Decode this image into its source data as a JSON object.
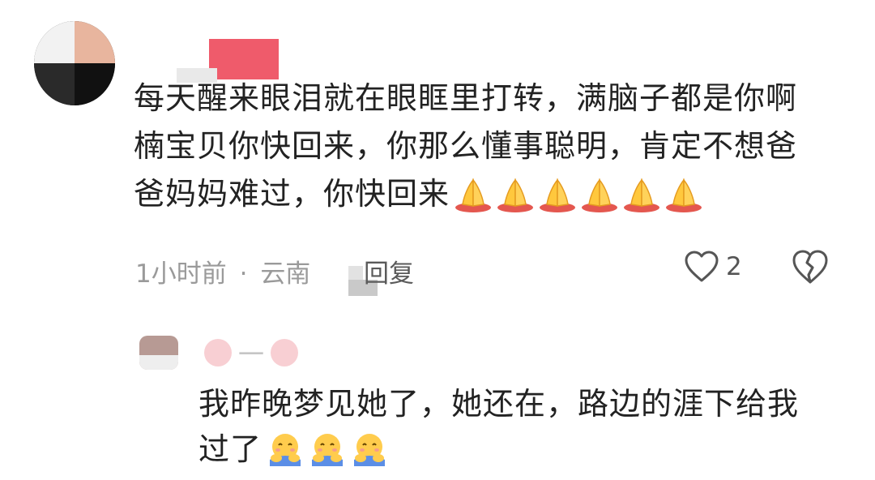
{
  "comment": {
    "text_lines": [
      "每天醒来眼泪就在眼眶里打转，满脑子都是你啊",
      "楠宝贝你快回来，你那么懂事聪明，肯定不想爸",
      "爸妈妈难过，你快回来"
    ],
    "emoji_name": "folded-hands-emoji",
    "emoji_count": 6,
    "time": "1小时前",
    "separator": "·",
    "location": "云南",
    "reply_label": "回复",
    "like_count": "2"
  },
  "reply": {
    "username": "一",
    "text_lines": [
      "我昨晚梦见她了，她还在，路边的涯下给我",
      "过了"
    ],
    "emoji_name": "hugging-face-emoji",
    "emoji_count": 3
  },
  "colors": {
    "text": "#222222",
    "meta": "#9a9a9a"
  }
}
